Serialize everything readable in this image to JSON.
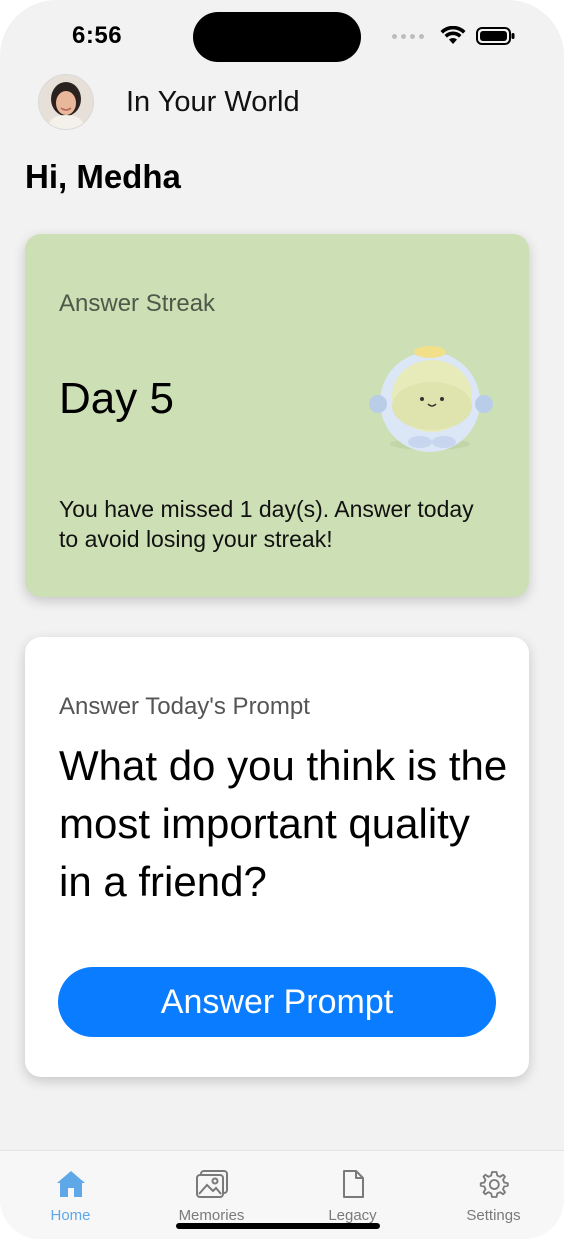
{
  "status_bar": {
    "time": "6:56"
  },
  "header": {
    "title": "In Your World",
    "avatar_icon": "user-avatar"
  },
  "greeting": "Hi, Medha",
  "streak_card": {
    "label": "Answer Streak",
    "day": "Day 5",
    "message": "You have missed 1 day(s). Answer today to avoid losing your streak!",
    "background": "#cddfb4"
  },
  "prompt_card": {
    "label": "Answer Today's Prompt",
    "question": "What do you think is the most important quality in a friend?",
    "button_label": "Answer Prompt",
    "button_color": "#0a7cff"
  },
  "tab_bar": {
    "active_color": "#5fa8e8",
    "tabs": [
      {
        "label": "Home",
        "icon": "home-icon"
      },
      {
        "label": "Memories",
        "icon": "photo-icon"
      },
      {
        "label": "Legacy",
        "icon": "document-icon"
      },
      {
        "label": "Settings",
        "icon": "gear-icon"
      }
    ]
  }
}
